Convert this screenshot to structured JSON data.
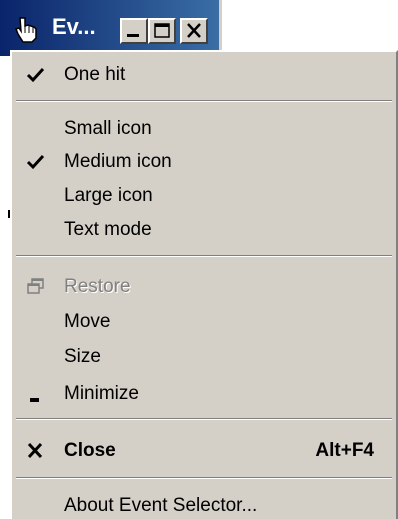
{
  "window": {
    "title": "Ev...",
    "icon": "hand-pointer-icon",
    "buttons": [
      "minimize",
      "maximize",
      "close"
    ]
  },
  "menu": {
    "items": [
      {
        "label": "One hit",
        "checked": true
      },
      {
        "label": "Small icon",
        "checked": false
      },
      {
        "label": "Medium icon",
        "checked": true
      },
      {
        "label": "Large icon",
        "checked": false
      },
      {
        "label": "Text mode",
        "checked": false
      },
      {
        "label": "Restore",
        "disabled": true,
        "icon": "restore-icon"
      },
      {
        "label": "Move"
      },
      {
        "label": "Size"
      },
      {
        "label": "Minimize",
        "icon": "minimize-icon"
      },
      {
        "label": "Close",
        "bold": true,
        "icon": "close-icon",
        "shortcut": "Alt+F4"
      },
      {
        "label": "About Event Selector..."
      }
    ]
  },
  "colors": {
    "menu_bg": "#d4d0c8",
    "titlebar_start": "#0a246a",
    "titlebar_end": "#3a6ea5",
    "disabled_text": "#808080"
  }
}
